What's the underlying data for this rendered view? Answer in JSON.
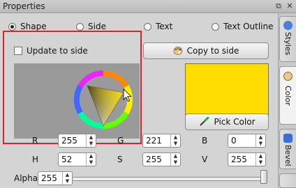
{
  "window": {
    "title": "Properties",
    "float_icon": "⧉",
    "close_icon": "✕"
  },
  "modes": {
    "shape": "Shape",
    "side": "Side",
    "text": "Text",
    "text_outline": "Text Outline",
    "selected": "Shape"
  },
  "update_to_side": {
    "label": "Update to side",
    "checked": false
  },
  "copy_to_side": {
    "label": "Copy to side",
    "icon": "palette-icon"
  },
  "current_color": {
    "hex": "#FFDD00"
  },
  "pick_color": {
    "label": "Pick Color",
    "icon": "eyedropper-icon"
  },
  "fields": {
    "r": {
      "label": "R",
      "value": "255"
    },
    "g": {
      "label": "G",
      "value": "221"
    },
    "b": {
      "label": "B",
      "value": "0"
    },
    "h": {
      "label": "H",
      "value": "52"
    },
    "s": {
      "label": "S",
      "value": "255"
    },
    "v": {
      "label": "V",
      "value": "255"
    }
  },
  "alpha": {
    "label": "Alpha",
    "value": "255",
    "level": 1.0
  },
  "side_tabs": {
    "styles": {
      "label": "Styles",
      "icon": "styles-icon"
    },
    "color": {
      "label": "Color",
      "icon": "palette-icon"
    },
    "bevel": {
      "label": "Bevel",
      "icon": "bevel-icon"
    }
  },
  "colors": {
    "highlight": "#E0202A",
    "swatch": "#FFDD00"
  }
}
